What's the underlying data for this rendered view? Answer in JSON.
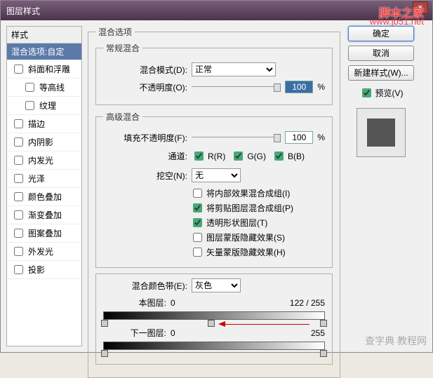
{
  "title": "图层样式",
  "watermark": {
    "brand": "脚本之家",
    "url": "www.jb51.net",
    "credit": "查字典 教程网"
  },
  "styles": {
    "header": "样式",
    "items": [
      {
        "label": "混合选项:自定",
        "selected": true,
        "checkbox": false,
        "indent": false
      },
      {
        "label": "斜面和浮雕",
        "selected": false,
        "checkbox": true,
        "checked": false,
        "indent": false
      },
      {
        "label": "等高线",
        "selected": false,
        "checkbox": true,
        "checked": false,
        "indent": true
      },
      {
        "label": "纹理",
        "selected": false,
        "checkbox": true,
        "checked": false,
        "indent": true
      },
      {
        "label": "描边",
        "selected": false,
        "checkbox": true,
        "checked": false,
        "indent": false
      },
      {
        "label": "内阴影",
        "selected": false,
        "checkbox": true,
        "checked": false,
        "indent": false
      },
      {
        "label": "内发光",
        "selected": false,
        "checkbox": true,
        "checked": false,
        "indent": false
      },
      {
        "label": "光泽",
        "selected": false,
        "checkbox": true,
        "checked": false,
        "indent": false
      },
      {
        "label": "颜色叠加",
        "selected": false,
        "checkbox": true,
        "checked": false,
        "indent": false
      },
      {
        "label": "渐变叠加",
        "selected": false,
        "checkbox": true,
        "checked": false,
        "indent": false
      },
      {
        "label": "图案叠加",
        "selected": false,
        "checkbox": true,
        "checked": false,
        "indent": false
      },
      {
        "label": "外发光",
        "selected": false,
        "checkbox": true,
        "checked": false,
        "indent": false
      },
      {
        "label": "投影",
        "selected": false,
        "checkbox": true,
        "checked": false,
        "indent": false
      }
    ]
  },
  "options": {
    "group_title": "混合选项",
    "general": {
      "legend": "常规混合",
      "blend_mode_label": "混合模式(D):",
      "blend_mode_value": "正常",
      "opacity_label": "不透明度(O):",
      "opacity_value": "100",
      "percent": "%"
    },
    "advanced": {
      "legend": "高级混合",
      "fill_label": "填充不透明度(F):",
      "fill_value": "100",
      "channels_label": "通道:",
      "channels": [
        {
          "label": "R(R)",
          "checked": true
        },
        {
          "label": "G(G)",
          "checked": true
        },
        {
          "label": "B(B)",
          "checked": true
        }
      ],
      "knockout_label": "挖空(N):",
      "knockout_value": "无",
      "checks": [
        {
          "label": "将内部效果混合成组(I)",
          "checked": false
        },
        {
          "label": "将剪贴图层混合成组(P)",
          "checked": true
        },
        {
          "label": "透明形状图层(T)",
          "checked": true
        },
        {
          "label": "图层蒙版隐藏效果(S)",
          "checked": false
        },
        {
          "label": "矢量蒙版隐藏效果(H)",
          "checked": false
        }
      ]
    },
    "blend_if": {
      "label": "混合颜色带(E):",
      "value": "灰色",
      "this_layer_label": "本图层:",
      "this_low": "0",
      "this_high": "122",
      "sep": "/",
      "this_max": "255",
      "under_layer_label": "下一图层:",
      "under_low": "0",
      "under_high": "255"
    }
  },
  "buttons": {
    "ok": "确定",
    "cancel": "取消",
    "new_style": "新建样式(W)...",
    "preview": "预览(V)"
  }
}
